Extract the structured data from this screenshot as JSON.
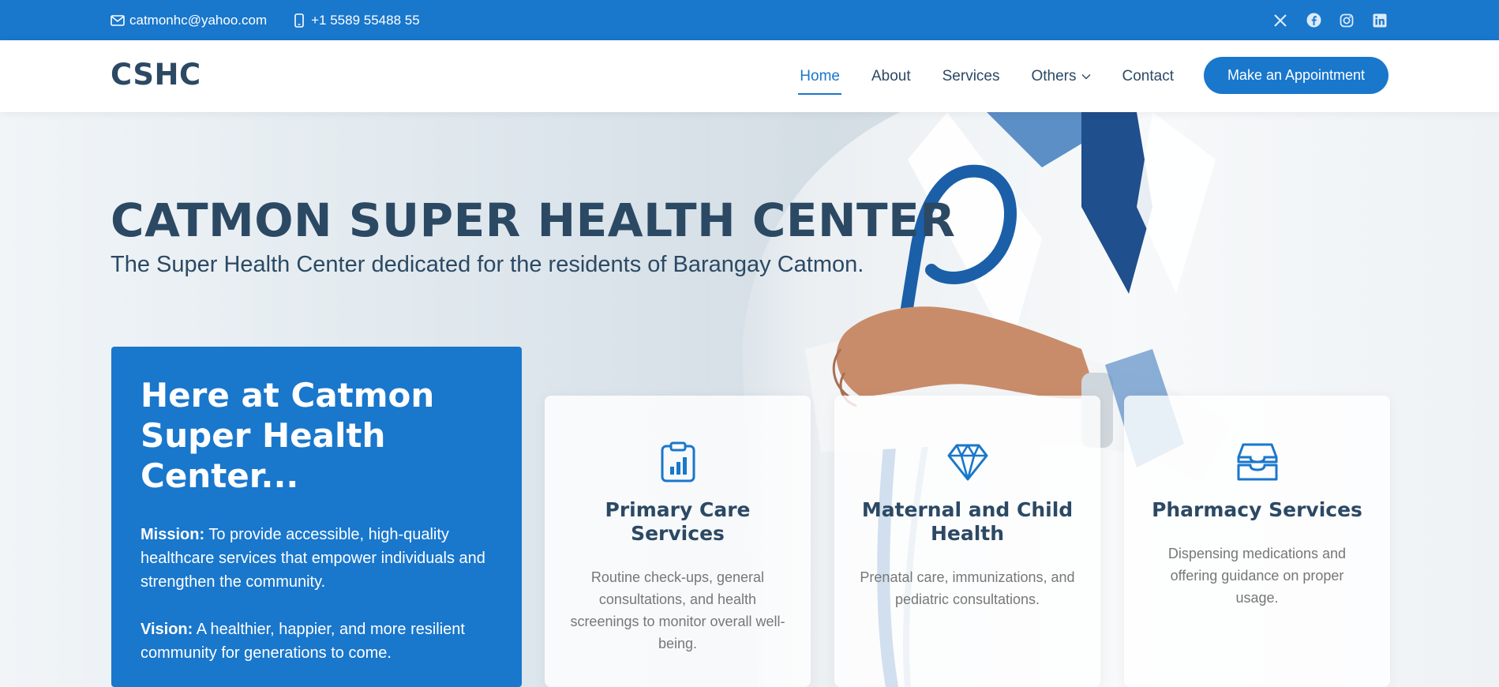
{
  "topbar": {
    "email": "catmonhc@yahoo.com",
    "phone": "+1 5589 55488 55",
    "social": [
      "x-icon",
      "facebook-icon",
      "instagram-icon",
      "linkedin-icon"
    ]
  },
  "header": {
    "logo": "CSHC",
    "nav": [
      {
        "label": "Home",
        "active": true
      },
      {
        "label": "About"
      },
      {
        "label": "Services"
      },
      {
        "label": "Others",
        "dropdown": true
      },
      {
        "label": "Contact"
      }
    ],
    "cta": "Make an Appointment"
  },
  "hero": {
    "title": "CATMON SUPER HEALTH CENTER",
    "subtitle": "The Super Health Center dedicated for the residents of Barangay Catmon."
  },
  "why_box": {
    "heading": "Here at Catmon Super Health Center...",
    "mission_label": "Mission:",
    "mission_text": " To provide accessible, high-quality healthcare services that empower individuals and strengthen the community.",
    "vision_label": "Vision:",
    "vision_text": " A healthier, happier, and more resilient community for generations to come."
  },
  "cards": [
    {
      "icon": "clipboard-data-icon",
      "title": "Primary Care Services",
      "text": "Routine check-ups, general consultations, and health screenings to monitor overall well-being."
    },
    {
      "icon": "gem-icon",
      "title": "Maternal and Child Health",
      "text": "Prenatal care, immunizations, and pediatric consultations."
    },
    {
      "icon": "inboxes-icon",
      "title": "Pharmacy Services",
      "text": "Dispensing medications and offering guidance on proper usage."
    }
  ],
  "colors": {
    "accent": "#1977cc",
    "heading": "#2c4964",
    "muted": "#777777"
  }
}
